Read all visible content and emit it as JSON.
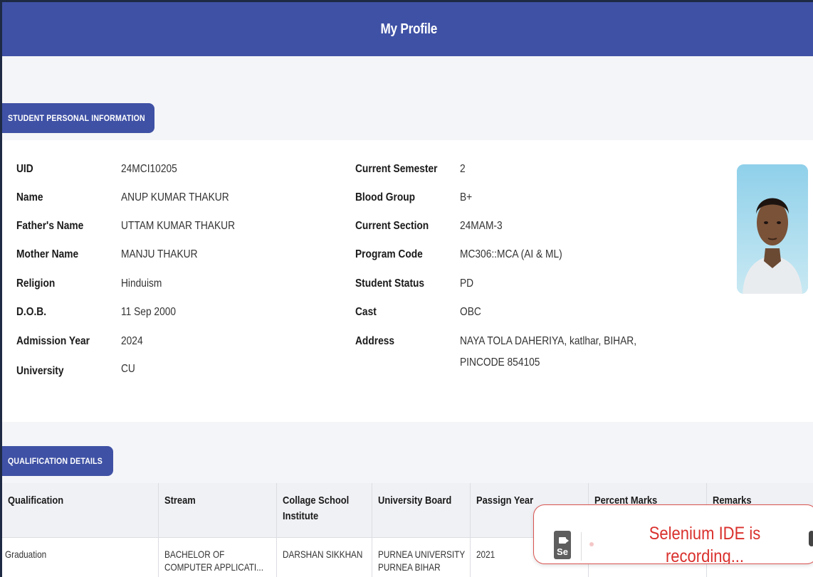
{
  "header": {
    "title": "My Profile"
  },
  "sections": {
    "personal": "STUDENT PERSONAL INFORMATION",
    "qualification": "QUALIFICATION DETAILS"
  },
  "personal_left": [
    {
      "label": "UID",
      "value": "24MCI10205"
    },
    {
      "label": "Name",
      "value": "ANUP KUMAR THAKUR"
    },
    {
      "label": "Father's Name",
      "value": "UTTAM KUMAR THAKUR"
    },
    {
      "label": "Mother Name",
      "value": "MANJU THAKUR"
    },
    {
      "label": "Religion",
      "value": "Hinduism"
    },
    {
      "label": "D.O.B.",
      "value": "11 Sep 2000"
    },
    {
      "label": "Admission Year",
      "value": "2024"
    },
    {
      "label": "University",
      "value": "CU"
    }
  ],
  "personal_right": [
    {
      "label": "Current Semester",
      "value": "2"
    },
    {
      "label": "Blood Group",
      "value": "B+"
    },
    {
      "label": "Current Section",
      "value": "24MAM-3"
    },
    {
      "label": "Program Code",
      "value": "MC306::MCA (AI & ML)"
    },
    {
      "label": "Student Status",
      "value": "PD"
    },
    {
      "label": "Cast",
      "value": "OBC"
    },
    {
      "label": "Address",
      "value_line1": "NAYA TOLA DAHERIYA, katlhar, BIHAR,",
      "value_line2": "PINCODE 854105"
    }
  ],
  "qualification_table": {
    "headers": [
      "Qualification",
      "Stream",
      "Collage School Institute",
      "University Board",
      "Passign Year",
      "Percent Marks",
      "Remarks"
    ],
    "rows": [
      [
        "Graduation",
        "BACHELOR OF COMPUTER APPLICATI...",
        "DARSHAN SIKKHAN",
        "PURNEA UNIVERSITY PURNEA BIHAR",
        "2021",
        "",
        ""
      ]
    ]
  },
  "toast": {
    "badge": "Se",
    "message": "Selenium IDE is recording..."
  },
  "colors": {
    "primary": "#3f51a5",
    "band": "#f4f5f8",
    "toast_text": "#d9302c"
  }
}
